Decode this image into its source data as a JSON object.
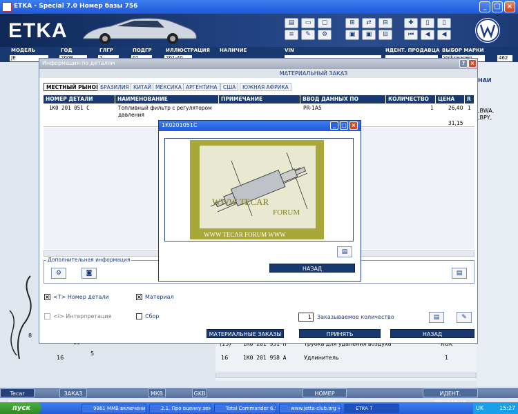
{
  "app": {
    "title": "ETKA - Special 7.0 Номер базы 756",
    "logo": "ETKA"
  },
  "fields": {
    "labels": [
      "МОДЕЛЬ",
      "ГОД",
      "ГЛГР",
      "ПОДГР",
      "ИЛЛЮСТРАЦИЯ",
      "НАЛИЧИЕ",
      "VIN",
      "ИДЕНТ. ПРОДАВЦА",
      "ВЫБОР МАРКИ"
    ],
    "values": {
      "model": "JE",
      "year": "2008",
      "glgr": "2",
      "podgr": "01",
      "illustration": "201-40",
      "brand": "Volkswagen",
      "dealer_num": "462"
    }
  },
  "info_window": {
    "title": "Информация по деталям",
    "header": "МАТЕРИАЛЬНЫЙ ЗАКАЗ",
    "tabs": [
      "МЕСТНЫЙ РЫНОК",
      "БРАЗИЛИЯ",
      "КИТАЙ",
      "МЕКСИКА",
      "АРГЕНТИНА",
      "США",
      "ЮЖНАЯ АФРИКА"
    ],
    "columns": [
      "НОМЕР ДЕТАЛИ",
      "НАИМЕНОВАНИЕ",
      "ПРИМЕЧАНИЕ",
      "ВВОД ДАННЫХ ПО МОДЕЛИ",
      "КОЛИЧЕСТВО",
      "ЦЕНА",
      "R"
    ],
    "row": {
      "part_number": "1K0 201 051 C",
      "name_line1": "Топливный фильтр с регулятором",
      "name_line2": "давления",
      "model_data": "PR-1A5",
      "quantity": "1",
      "price": "26,40",
      "price_total": "31,15",
      "r": "1"
    },
    "extra_info_label": "Дополнительная информация",
    "check_part_number": "<T> Номер детали",
    "check_material": "Материал",
    "check_interpretation": "<I> Интерпретация",
    "check_assembly": "Сбор",
    "order_qty_value": "1",
    "order_qty_label": "Заказываемое количество",
    "btn_material_orders": "МАТЕРИАЛЬНЫЕ ЗАКАЗЫ",
    "btn_accept": "ПРИНЯТЬ",
    "btn_back": "НАЗАД"
  },
  "image_window": {
    "title": "1K0201051C",
    "watermark_line1": "WWW TECAR",
    "watermark_line2": "FORUM",
    "watermark_bottom": "WWW TECAR FORUM WWW",
    "btn_back": "НАЗАД"
  },
  "background": {
    "right_header": "НАИ",
    "right_codes_1": ",BWA,",
    "right_codes_2": ",BPY,",
    "rows": [
      {
        "pos": "(15)",
        "part": "1K0 201 931 H",
        "name": "Трубка для удаления воздуха",
        "qty": "",
        "code": "ROK"
      },
      {
        "pos": "16",
        "part": "1K0 201 958 A",
        "name": "Удлинитель",
        "qty": "1",
        "code": ""
      }
    ],
    "diagram_labels": [
      "8",
      "16",
      "5",
      "10"
    ]
  },
  "bottom_bar": {
    "items": [
      "Tecar Forum",
      "ЗАКАЗ",
      "МКВ",
      "GKB",
      "НОМЕР ШАССИ",
      "ИДЕНТ. ПРОДАВЦА"
    ]
  },
  "taskbar": {
    "start": "пуск",
    "items": [
      "9861 MMB включени...",
      "2.1. Про оценку земе...",
      "Total Commander 6.5...",
      "www.jetta-club.org »...",
      "ETKA 7"
    ],
    "lang": "UK",
    "time": "15:27"
  },
  "colors": {
    "accent": "#18386f",
    "title_blue": "#245edb",
    "close_red": "#d24a2a"
  }
}
